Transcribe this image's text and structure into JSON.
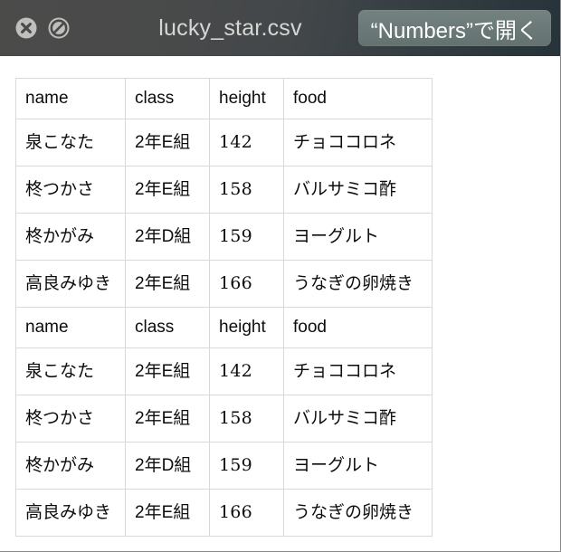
{
  "window": {
    "title": "lucky_star.csv",
    "titlebar_left_color": "#4b4b4a",
    "titlebar_right_color": "#27333a",
    "content_background": "#ffffff",
    "border_color": "#8a8a8a"
  },
  "titlebar": {
    "close_icon": "close-circle-icon",
    "block_icon": "prohibited-circle-icon",
    "open_button": {
      "label": "“Numbers”で開く",
      "quote_open": "“",
      "app_name": "Numbers",
      "quote_close": "”",
      "suffix": "で開く",
      "background_color": "#6b7a79",
      "text_color": "#ffffff"
    }
  },
  "table": {
    "columns": [
      "name",
      "class",
      "height",
      "food"
    ],
    "border_color": "#d9d9d9",
    "blocks": [
      {
        "header": [
          "name",
          "class",
          "height",
          "food"
        ],
        "rows": [
          [
            "泉こなた",
            "2年E組",
            "142",
            "チョココロネ"
          ],
          [
            "柊つかさ",
            "2年E組",
            "158",
            "バルサミコ酢"
          ],
          [
            "柊かがみ",
            "2年D組",
            "159",
            "ヨーグルト"
          ],
          [
            "高良みゆき",
            "2年E組",
            "166",
            "うなぎの卵焼き"
          ]
        ]
      },
      {
        "header": [
          "name",
          "class",
          "height",
          "food"
        ],
        "rows": [
          [
            "泉こなた",
            "2年E組",
            "142",
            "チョココロネ"
          ],
          [
            "柊つかさ",
            "2年E組",
            "158",
            "バルサミコ酢"
          ],
          [
            "柊かがみ",
            "2年D組",
            "159",
            "ヨーグルト"
          ],
          [
            "高良みゆき",
            "2年E組",
            "166",
            "うなぎの卵焼き"
          ]
        ]
      }
    ]
  }
}
